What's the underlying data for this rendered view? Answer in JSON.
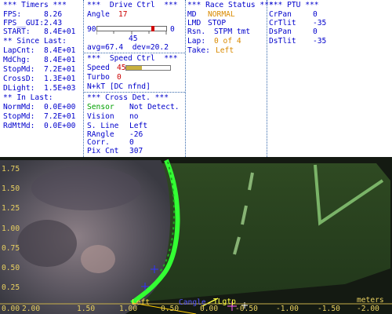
{
  "telemetry": {
    "timers_title": "*** Timers ***",
    "fps_k": "FPS:",
    "fps_v": "8.26",
    "fpsgui_k": "FPS__GUI:",
    "fpsgui_v": "2.43",
    "start_k": "START:",
    "start_v": "8.4E+01",
    "since_title": "** Since Last:",
    "lapcnt_k": "LapCnt:",
    "lapcnt_v": "8.4E+01",
    "mdchg_k": "MdChg:",
    "mdchg_v": "8.4E+01",
    "stopmd_k": "StopMd:",
    "stopmd_v": "7.2E+01",
    "crossd_k": "CrossD:",
    "crossd_v": "1.3E+01",
    "dlight_k": "DLight:",
    "dlight_v": "1.5E+03",
    "inlast_title": "** In Last:",
    "normmd_k": "NormMd:",
    "normmd_v": "0.0E+00",
    "stopmd2_k": "StopMd:",
    "stopmd2_v": "7.2E+01",
    "rdmtmd_k": "RdMtMd:",
    "rdmtmd_v": "0.0E+00"
  },
  "drive": {
    "title": "***  Drive Ctrl  ***",
    "angle_k": "Angle",
    "angle_v": "17",
    "slider_left": "90",
    "slider_right": "0",
    "slider_value": 0.82,
    "slider_center": "45",
    "avg_dev": "avg=67.4  dev=20.2",
    "speed_title": "***  Speed Ctrl  ***",
    "speed_k": "Speed",
    "speed_v": "45",
    "speed_level": 0.35,
    "turbo_k": "Turbo",
    "turbo_v": "0",
    "nkt": "N+kT [DC nfnd]"
  },
  "cross": {
    "title": "*** Cross Det. ***",
    "sensor_k": "Sensor",
    "sensor_v": "Not Detect.",
    "vision_k": "Vision",
    "vision_v": "no",
    "sline_k": "S. Line",
    "sline_v": "Left",
    "rangle_k": "RAngle",
    "rangle_v": "-26",
    "corr_k": "Corr.",
    "corr_v": "0",
    "pixcnt_k": "Pix Cnt",
    "pixcnt_v": "307"
  },
  "race": {
    "title": "*** Race Status ***",
    "md_k": "MD",
    "md_v": "NORMAL",
    "lmd_k": "LMD",
    "lmd_v": "STOP",
    "rsn_k": "Rsn.",
    "rsn_v": "STPM tmt",
    "lap_k": "Lap:",
    "lap_v": "0 of 4",
    "take_k": "Take:",
    "take_v": "Left"
  },
  "ptu": {
    "title": "*** PTU ***",
    "crpan_k": "CrPan",
    "crpan_v": "0",
    "crtilt_k": "CrTlit",
    "crtilt_v": "-35",
    "dspan_k": "DsPan",
    "dspan_v": "0",
    "dstilt_k": "DsTlit",
    "dstilt_v": "-35"
  },
  "camera": {
    "y_ticks": [
      "1.75",
      "1.50",
      "1.25",
      "1.00",
      "0.75",
      "0.50",
      "0.25",
      "0.00"
    ],
    "x_ticks": [
      "2.00",
      "1.50",
      "1.00",
      "0.50",
      "0.00",
      "-0.50",
      "-1.00",
      "-1.50",
      "-2.00"
    ],
    "units": "meters",
    "left_label": "Left",
    "cangle_label": "Cangle",
    "tangle_label": "TLgtp"
  },
  "colors": {
    "text_blue": "#0000cc",
    "value_red": "#cc0000",
    "value_orange": "#d98a00",
    "sensor_green": "#00a000",
    "overlay_green": "#33ff33",
    "axis_yellow": "#e8d060"
  }
}
